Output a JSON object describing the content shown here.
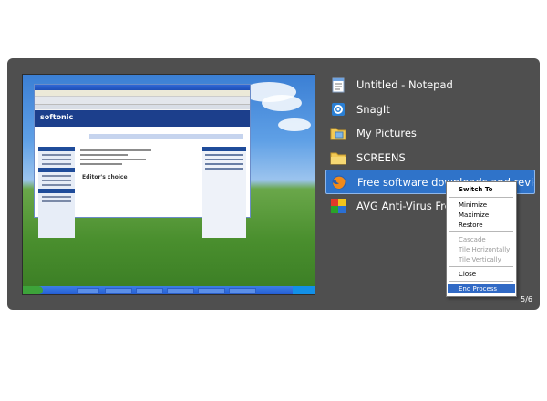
{
  "window_list": [
    {
      "label": "Untitled - Notepad",
      "icon": "notepad-icon"
    },
    {
      "label": "SnagIt",
      "icon": "snagit-icon"
    },
    {
      "label": "My Pictures",
      "icon": "folder-icon"
    },
    {
      "label": "SCREENS",
      "icon": "folder-icon"
    },
    {
      "label": "Free software downloads and reviews...",
      "icon": "firefox-icon",
      "selected": true
    },
    {
      "label": "AVG Anti-Virus Free",
      "icon": "avg-icon"
    }
  ],
  "counter": "5/6",
  "context_menu": {
    "switch_to": "Switch To",
    "minimize": "Minimize",
    "maximize": "Maximize",
    "restore": "Restore",
    "cascade": "Cascade",
    "tile_horizontally": "Tile Horizontally",
    "tile_vertically": "Tile Vertically",
    "close": "Close",
    "end_process": "End Process"
  },
  "preview": {
    "site_name": "softonic",
    "section_heading": "Editor's choice"
  },
  "colors": {
    "panel": "#4f4f4f",
    "selection": "#2f73c9",
    "menu_highlight": "#316ac5"
  }
}
